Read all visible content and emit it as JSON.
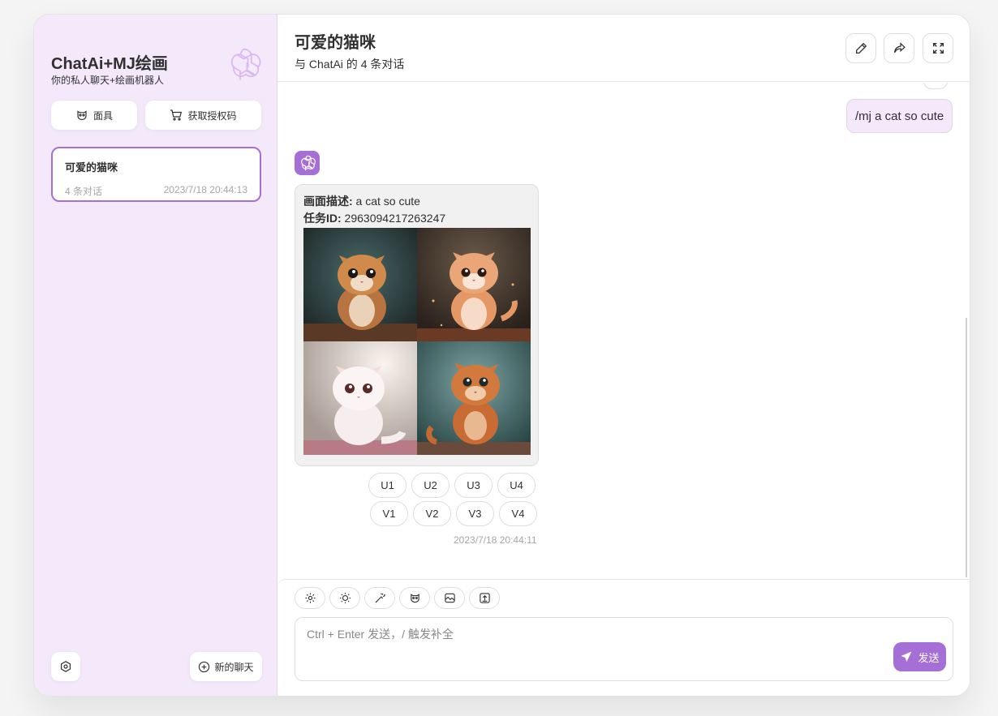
{
  "colors": {
    "accent": "#a66fd6",
    "sidebar_bg": "#f4e8fb",
    "bubble_bg": "#f1f1f1"
  },
  "sidebar": {
    "title": "ChatAi+MJ绘画",
    "subtitle": "你的私人聊天+绘画机器人",
    "logo_icon": "openai-logo-icon",
    "mask_button": "面具",
    "auth_button": "获取授权码",
    "chats": [
      {
        "title": "可爱的猫咪",
        "count": "4 条对话",
        "time": "2023/7/18 20:44:13"
      }
    ],
    "new_chat": "新的聊天"
  },
  "header": {
    "title": "可爱的猫咪",
    "subtitle": "与 ChatAi 的 4 条对话"
  },
  "messages": {
    "user_text": "/mj a cat so cute",
    "bot": {
      "desc_label": "画面描述:",
      "desc_value": " a cat so cute",
      "task_label": "任务ID:",
      "task_value": " 2963094217263247",
      "upscale": [
        "U1",
        "U2",
        "U3",
        "U4"
      ],
      "variation": [
        "V1",
        "V2",
        "V3",
        "V4"
      ],
      "time": "2023/7/18 20:44:11"
    }
  },
  "composer": {
    "placeholder": "Ctrl + Enter 发送，/ 触发补全",
    "send": "发送",
    "tools": [
      "settings-icon",
      "theme-icon",
      "magic-wand-icon",
      "mask-icon",
      "image-icon",
      "export-icon"
    ]
  }
}
